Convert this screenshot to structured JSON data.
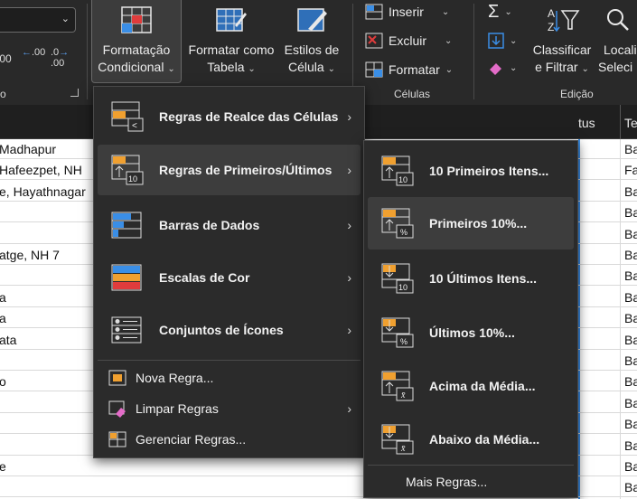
{
  "ribbon": {
    "cond_format": {
      "line1": "Formatação",
      "line2": "Condicional"
    },
    "format_table": {
      "line1": "Formatar como",
      "line2": "Tabela"
    },
    "cell_styles": {
      "line1": "Estilos de",
      "line2": "Célula"
    },
    "insert": "Inserir",
    "delete": "Excluir",
    "format": "Formatar",
    "cells_group": "Células",
    "sort_filter": {
      "line1": "Classificar",
      "line2": "e Filtrar"
    },
    "find_select": {
      "line1": "Locali",
      "line2": "Seleci"
    },
    "editing_group": "Edição",
    "number_group_partial": "o",
    "decimal_left": ".00",
    "increase_decimal": ".00",
    "decrease_decimal": ".0",
    "decrease_decimal_b": ".00"
  },
  "sheet": {
    "header_status": "tus",
    "header_te": "Te",
    "rows": [
      {
        "a": "Madhapur",
        "d": "Ba"
      },
      {
        "a": "Hafeezpet, NH",
        "d": "Fa"
      },
      {
        "a": "e, Hayathnagar",
        "d": "Ba"
      },
      {
        "a": "",
        "d": "Ba"
      },
      {
        "a": "",
        "d": "Ba"
      },
      {
        "a": "atge, NH 7",
        "d": "Ba"
      },
      {
        "a": "",
        "d": "Ba"
      },
      {
        "a": "a",
        "d": "Ba"
      },
      {
        "a": "a",
        "d": "Ba"
      },
      {
        "a": "ata",
        "d": "Ba"
      },
      {
        "a": "",
        "d": "Ba"
      },
      {
        "a": "o",
        "d": "Ba"
      },
      {
        "a": "",
        "d": "Ba"
      },
      {
        "a": "",
        "d": "Ba"
      },
      {
        "a": "",
        "d": "Ba"
      },
      {
        "a": "e",
        "d": "Ba"
      },
      {
        "a": "",
        "d": "Ba"
      }
    ]
  },
  "menu": {
    "items": [
      {
        "label": "Regras de Realce das Células"
      },
      {
        "label": "Regras de Primeiros/Últimos"
      },
      {
        "label": "Barras de Dados"
      },
      {
        "label": "Escalas de Cor"
      },
      {
        "label": "Conjuntos de Ícones"
      }
    ],
    "small": [
      {
        "label": "Nova Regra..."
      },
      {
        "label": "Limpar Regras"
      },
      {
        "label": "Gerenciar Regras..."
      }
    ],
    "icon_num": "10"
  },
  "submenu": {
    "items": [
      {
        "label": "10 Primeiros Itens...",
        "badge": "10"
      },
      {
        "label": "Primeiros 10%...",
        "badge": "%"
      },
      {
        "label": "10 Últimos Itens...",
        "badge": "10"
      },
      {
        "label": "Últimos 10%...",
        "badge": "%"
      },
      {
        "label": "Acima da Média...",
        "badge": "x̄"
      },
      {
        "label": "Abaixo da Média...",
        "badge": "x̄"
      }
    ],
    "more": "Mais Regras..."
  }
}
